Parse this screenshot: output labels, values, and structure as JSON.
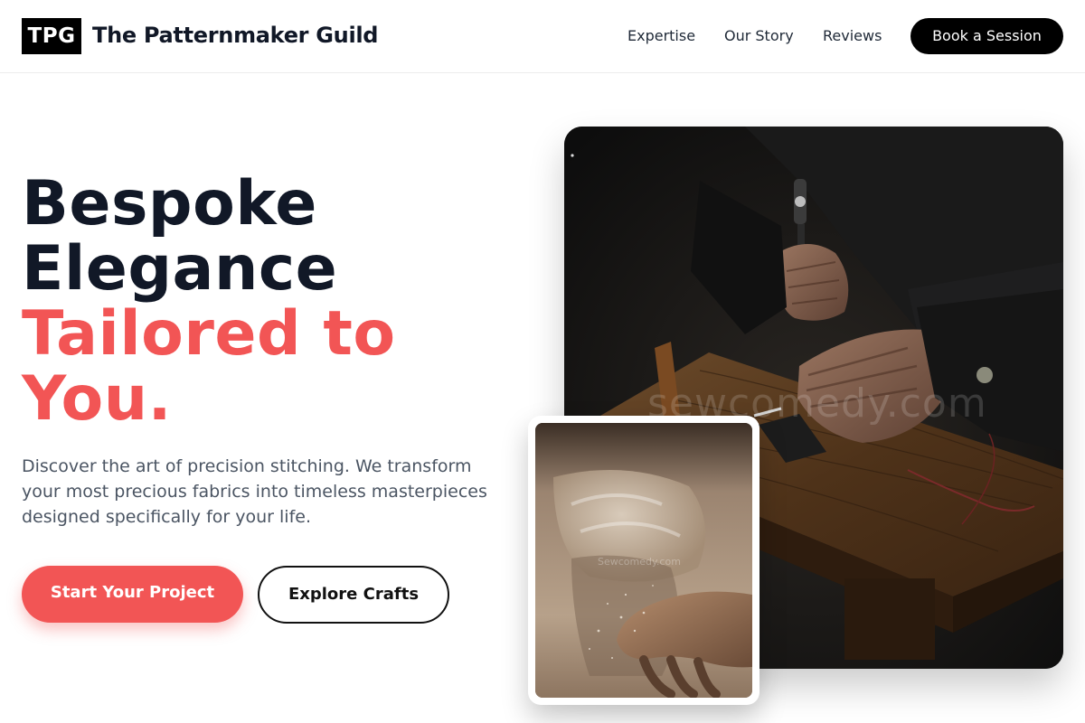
{
  "header": {
    "logo_text": "TPG",
    "brand_name": "The Patternmaker Guild",
    "nav": {
      "expertise": "Expertise",
      "story": "Our Story",
      "reviews": "Reviews"
    },
    "cta": "Book a Session"
  },
  "hero": {
    "title_line1": "Bespoke",
    "title_line2": "Elegance",
    "accent_line1": "Tailored to",
    "accent_line2": "You.",
    "description": "Discover the art of precision stitching. We transform your most precious fabrics into timeless masterpieces designed specifically for your life.",
    "primary_button": "Start Your Project",
    "secondary_button": "Explore Crafts"
  },
  "images": {
    "main_watermark": "sewcomedy.com",
    "inset_watermark": "Sewcomedy.com"
  },
  "colors": {
    "accent": "#f25555",
    "dark": "#111827",
    "muted": "#4b5563",
    "button_dark": "#000000"
  }
}
